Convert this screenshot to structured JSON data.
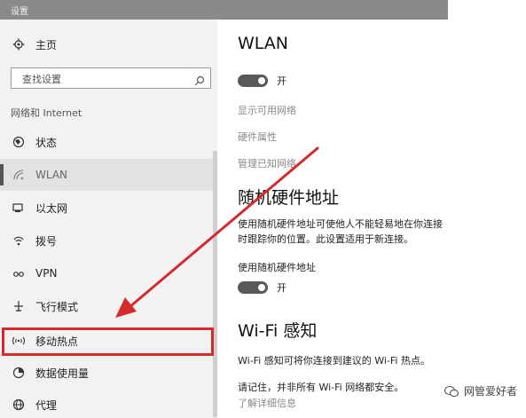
{
  "window": {
    "title": "设置"
  },
  "sidebar": {
    "home": {
      "label": "主页",
      "icon": "gear-icon"
    },
    "search": {
      "placeholder": "查找设置",
      "icon": "search-icon"
    },
    "section_label": "网络和 Internet",
    "items": [
      {
        "label": "状态",
        "icon": "globe-icon"
      },
      {
        "label": "WLAN",
        "icon": "wifi-icon",
        "selected": true
      },
      {
        "label": "以太网",
        "icon": "ethernet-icon"
      },
      {
        "label": "拨号",
        "icon": "dialup-icon"
      },
      {
        "label": "VPN",
        "icon": "vpn-icon"
      },
      {
        "label": "飞行模式",
        "icon": "airplane-icon"
      },
      {
        "label": "移动热点",
        "icon": "hotspot-icon",
        "highlighted": true
      },
      {
        "label": "数据使用量",
        "icon": "data-usage-icon"
      },
      {
        "label": "代理",
        "icon": "proxy-globe-icon"
      }
    ]
  },
  "content": {
    "wlan_title": "WLAN",
    "wlan_toggle": {
      "state_label": "开"
    },
    "links": [
      "显示可用网络",
      "硬件属性",
      "管理已知网络"
    ],
    "random_hw": {
      "title": "随机硬件地址",
      "desc_line1": "使用随机硬件地址可使他人不能轻易地在你连接",
      "desc_line2": "时跟踪你的位置。此设置适用于新连接。",
      "setting_label": "使用随机硬件地址",
      "toggle_label": "开"
    },
    "wifi_sense": {
      "title": "Wi-Fi 感知",
      "desc": "Wi-Fi 感知可将你连接到建议的 Wi-Fi 热点。",
      "note": "请记住，并非所有 Wi-Fi 网络都安全。",
      "learn_more": "了解详细信息"
    }
  },
  "watermark": {
    "text": "网管爱好者"
  },
  "colors": {
    "highlight": "#d42a2a",
    "arrow": "#d42a2a",
    "toggle_on": "#595959",
    "sidebar_bg": "#f2f2f2"
  }
}
